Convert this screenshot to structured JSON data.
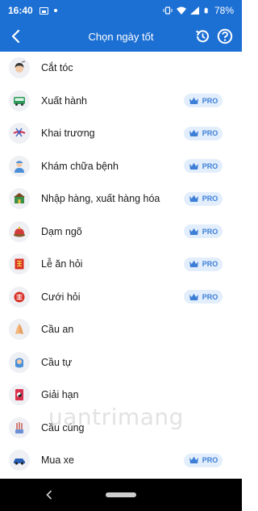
{
  "status_bar": {
    "time": "16:40",
    "battery": "78%"
  },
  "app_bar": {
    "title": "Chọn ngày tốt"
  },
  "items": [
    {
      "label": "Cắt tóc",
      "pro": ""
    },
    {
      "label": "Xuất hành",
      "pro": "PRO"
    },
    {
      "label": "Khai trương",
      "pro": "PRO"
    },
    {
      "label": "Khám chữa bệnh",
      "pro": "PRO"
    },
    {
      "label": "Nhập hàng, xuất hàng hóa",
      "pro": "PRO"
    },
    {
      "label": "Dạm ngõ",
      "pro": "PRO"
    },
    {
      "label": "Lễ ăn hỏi",
      "pro": "PRO"
    },
    {
      "label": "Cưới hỏi",
      "pro": "PRO"
    },
    {
      "label": "Cầu an",
      "pro": ""
    },
    {
      "label": "Cầu tự",
      "pro": ""
    },
    {
      "label": "Giải hạn",
      "pro": ""
    },
    {
      "label": "Cầu cúng",
      "pro": ""
    },
    {
      "label": "Mua xe",
      "pro": "PRO"
    }
  ],
  "watermark": "uantrimang",
  "colors": {
    "primary": "#1c6fd3",
    "pro_badge_bg": "#e3eefc",
    "pro_text": "#3d7fd6"
  }
}
